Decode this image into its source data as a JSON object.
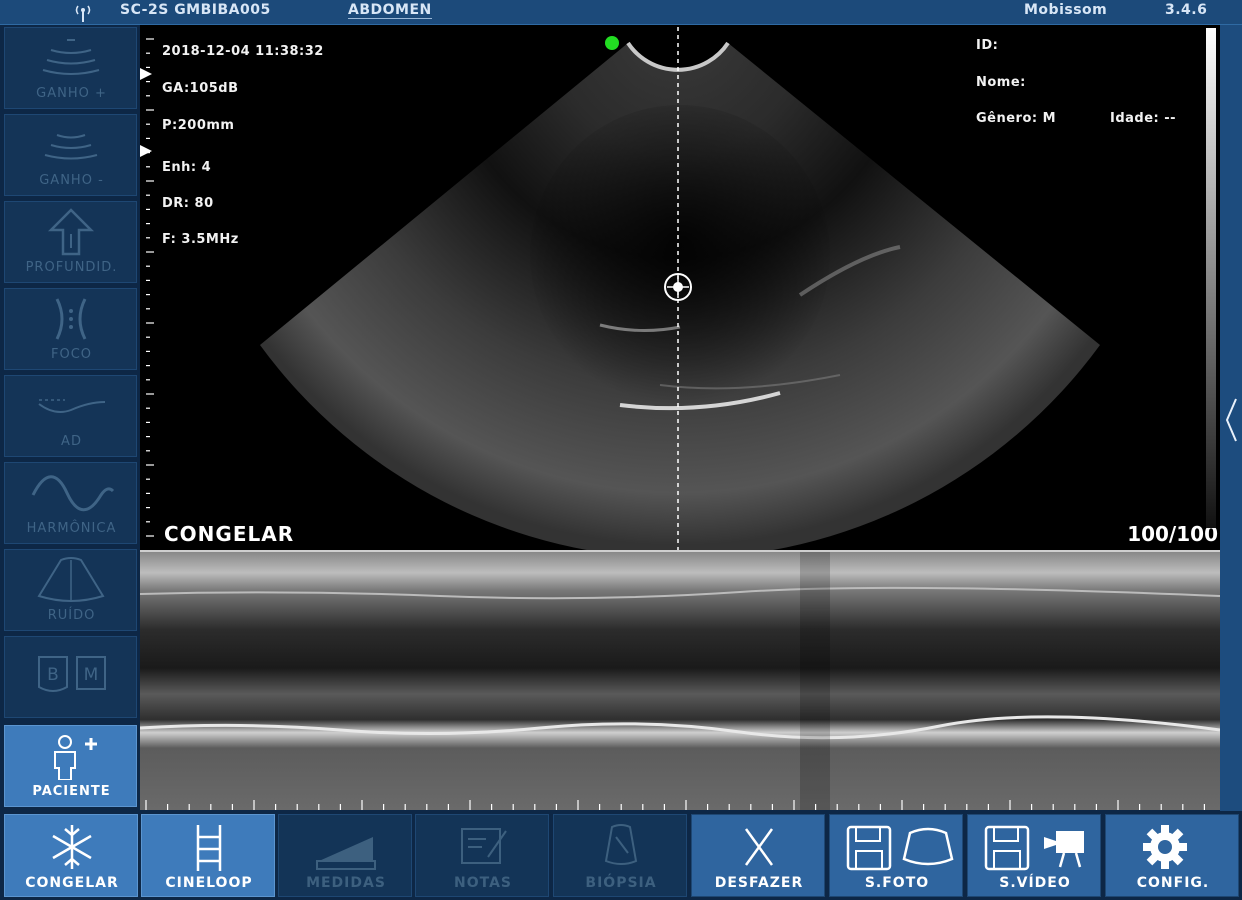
{
  "topbar": {
    "probe": "SC-2S GMBIBA005",
    "preset": "ABDOMEN",
    "brand": "Mobissom",
    "version": "3.4.6"
  },
  "sidebar": {
    "items": [
      {
        "label": "GANHO +",
        "icon": "gain-plus-icon",
        "active": false
      },
      {
        "label": "GANHO -",
        "icon": "gain-minus-icon",
        "active": false
      },
      {
        "label": "PROFUNDID.",
        "icon": "depth-arrow-icon",
        "active": false
      },
      {
        "label": "FOCO",
        "icon": "focus-icon",
        "active": false
      },
      {
        "label": "AD",
        "icon": "ad-wave-icon",
        "active": false
      },
      {
        "label": "HARMÔNICA",
        "icon": "harmonic-wave-icon",
        "active": false
      },
      {
        "label": "RUÍDO",
        "icon": "noise-sector-icon",
        "active": false
      },
      {
        "label": "",
        "icon": "bm-mode-icon",
        "active": false,
        "mode_b": "B",
        "mode_m": "M"
      },
      {
        "label": "PACIENTE",
        "icon": "patient-add-icon",
        "active": true
      }
    ]
  },
  "overlay": {
    "datetime": "2018-12-04 11:38:32",
    "gain": "GA:105dB",
    "power": "P:200mm",
    "enhance": "Enh: 4",
    "dynamic_range": "DR: 80",
    "frequency": "F: 3.5MHz",
    "freeze_label": "CONGELAR",
    "frame_counter": "100/100"
  },
  "patient": {
    "id_label": "ID:",
    "name_label": "Nome:",
    "gender_label": "Gênero: M",
    "age_label": "Idade: --"
  },
  "toolbar": {
    "items": [
      {
        "label": "CONGELAR",
        "icon": "snowflake-icon",
        "state": "on"
      },
      {
        "label": "CINELOOP",
        "icon": "film-strip-icon",
        "state": "on"
      },
      {
        "label": "MEDIDAS",
        "icon": "ruler-icon",
        "state": "disabled"
      },
      {
        "label": "NOTAS",
        "icon": "notes-icon",
        "state": "disabled"
      },
      {
        "label": "BIÓPSIA",
        "icon": "biopsy-icon",
        "state": "disabled"
      },
      {
        "label": "DESFAZER",
        "icon": "undo-x-icon",
        "state": "mid"
      },
      {
        "label": "S.FOTO",
        "icon": "save-photo-icon",
        "state": "mid"
      },
      {
        "label": "S.VÍDEO",
        "icon": "save-video-icon",
        "state": "mid"
      },
      {
        "label": "CONFIG.",
        "icon": "gear-icon",
        "state": "mid"
      }
    ]
  },
  "colors": {
    "accent": "#3e7bbb",
    "panel": "#143457",
    "background": "#0d2746",
    "topbar": "#1c4a7a",
    "indicator": "#22dd22"
  }
}
